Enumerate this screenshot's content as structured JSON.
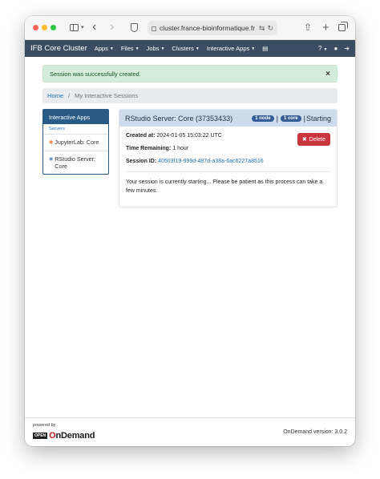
{
  "browser": {
    "url": "cluster.france-bioinformatique.fr"
  },
  "navbar": {
    "brand": "IFB Core Cluster",
    "items": [
      {
        "label": "Apps"
      },
      {
        "label": "Files"
      },
      {
        "label": "Jobs"
      },
      {
        "label": "Clusters"
      },
      {
        "label": "Interactive Apps"
      }
    ]
  },
  "alert": {
    "message": "Session was successfully created.",
    "close": "×"
  },
  "breadcrumb": {
    "home": "Home",
    "separator": "/",
    "current": "My Interactive Sessions"
  },
  "sidebar": {
    "header": "Interactive Apps",
    "category": "Servers",
    "items": [
      {
        "label": "JupyterLab: Core"
      },
      {
        "label": "RStudio Server: Core"
      }
    ]
  },
  "session": {
    "title": "RStudio Server: Core (37353433)",
    "nodes_badge": "1 node",
    "cores_badge": "1 core",
    "sep1": "|",
    "sep2": "|",
    "status": "Starting",
    "created_label": "Created at:",
    "created_value": "2024-01-05 15:03:22 UTC",
    "remaining_label": "Time Remaining:",
    "remaining_value": "1 hour",
    "id_label": "Session ID:",
    "id_value": "40503f19-999d-487d-a38a-6ac6227a8516",
    "delete_label": "Delete",
    "note": "Your session is currently starting... Please be patient as this process can take a few minutes."
  },
  "footer": {
    "powered_by": "powered by",
    "logo_open": "OPEN",
    "logo_text": "OnDemand",
    "version": "OnDemand version: 3.0.2"
  }
}
